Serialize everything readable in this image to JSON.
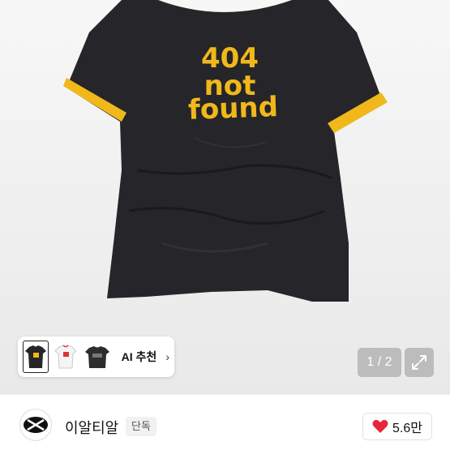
{
  "product": {
    "print_line1": "404",
    "print_line2": "not",
    "print_line3": "found",
    "shirt_color": "#25252a",
    "trim_color": "#f0b81a"
  },
  "thumbnails": {
    "ai_label": "AI 추천",
    "items": [
      {
        "icon": "thumbnail-black-tee"
      },
      {
        "icon": "thumbnail-white-tee"
      },
      {
        "icon": "thumbnail-dark-tee"
      }
    ]
  },
  "gallery": {
    "counter": "1 / 2"
  },
  "store": {
    "name": "이알티알",
    "badge": "단독",
    "likes": "5.6만",
    "like_color": "#e8253a"
  }
}
